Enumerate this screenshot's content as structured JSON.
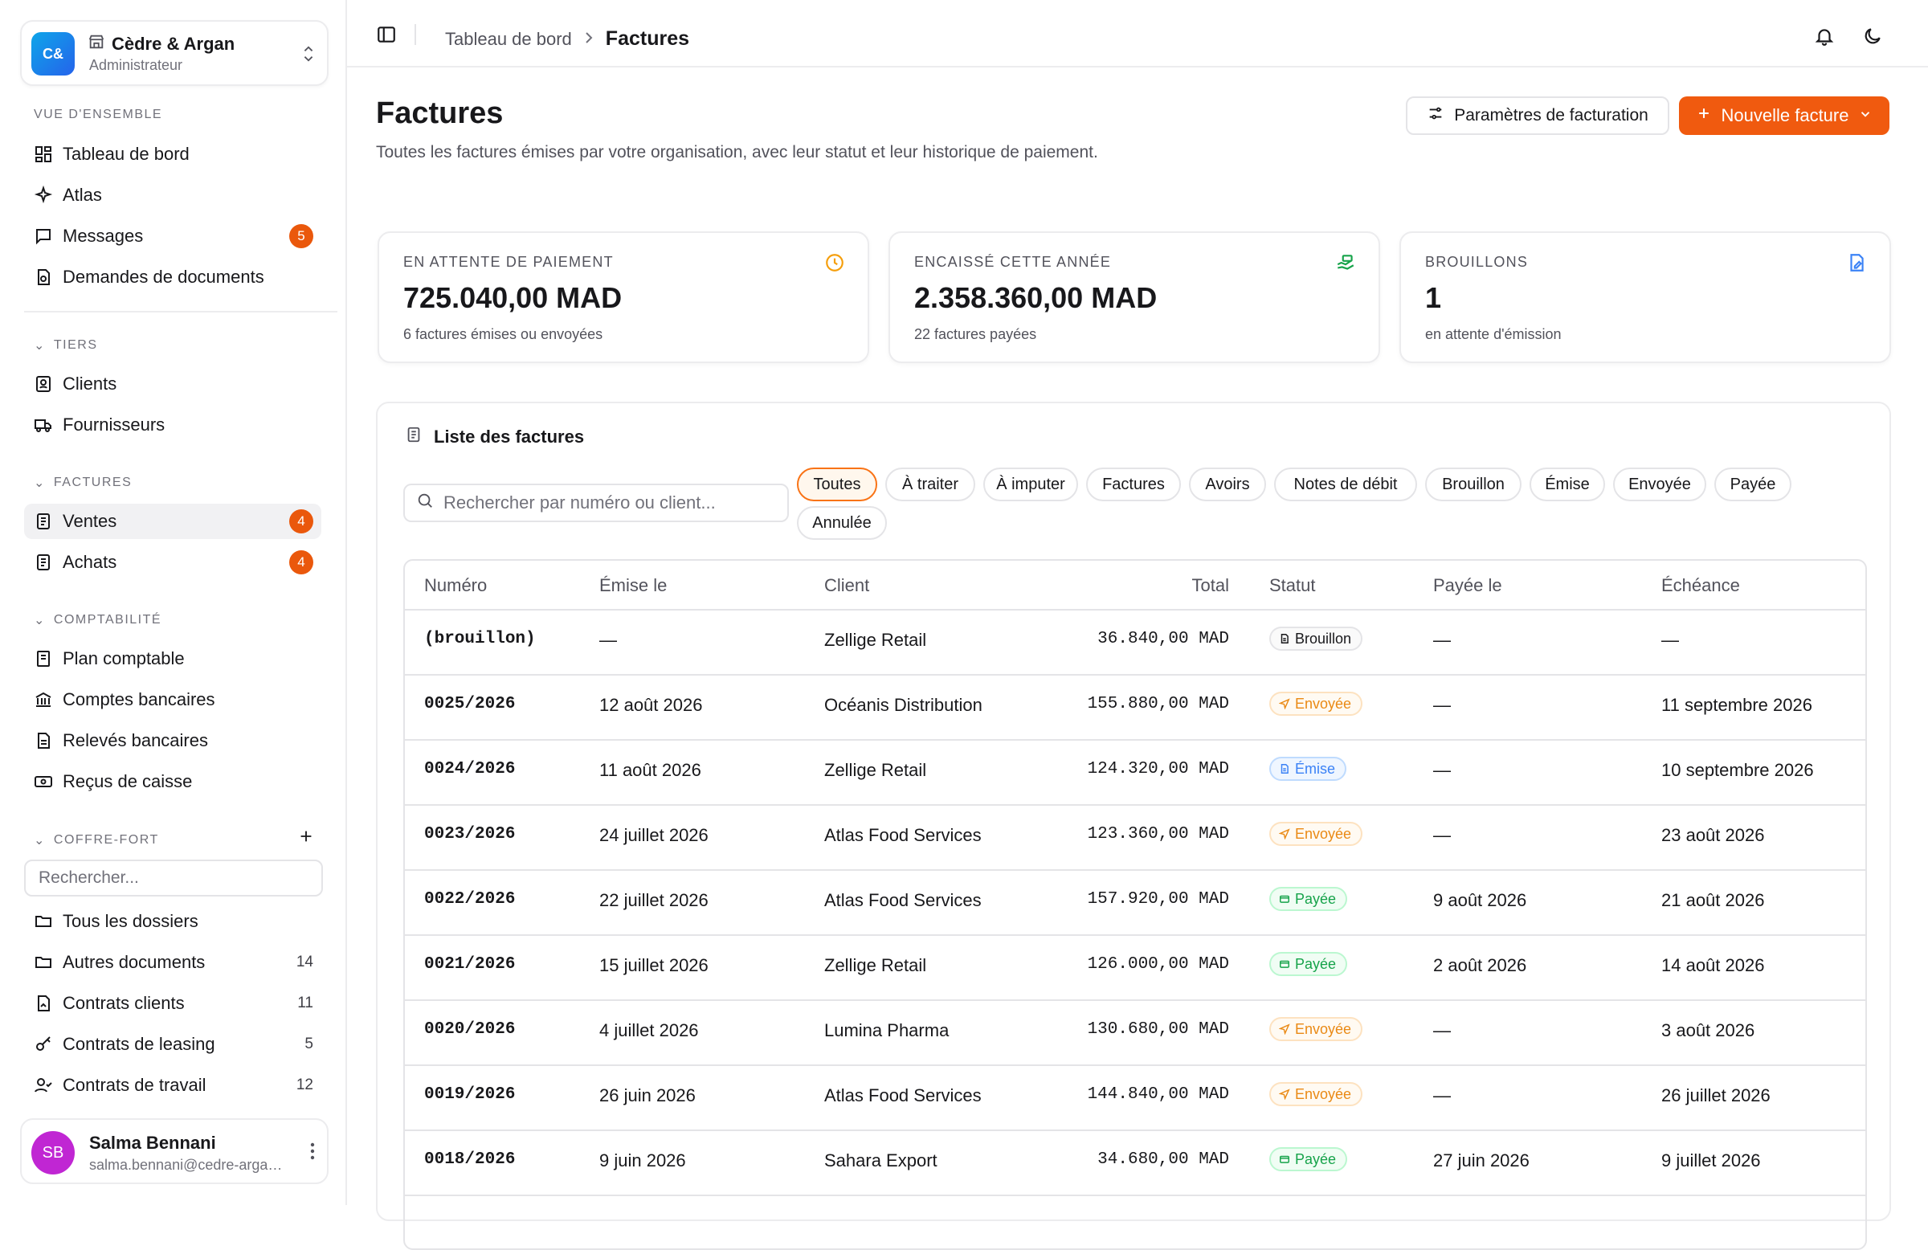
{
  "org": {
    "initials": "C&",
    "name": "Cèdre & Argan",
    "role": "Administrateur"
  },
  "sidebar": {
    "overview": {
      "title": "VUE D'ENSEMBLE",
      "items": [
        {
          "label": "Tableau de bord",
          "icon": "dashboard-icon"
        },
        {
          "label": "Atlas",
          "icon": "sparkle-icon"
        },
        {
          "label": "Messages",
          "icon": "message-icon",
          "badge": "5"
        },
        {
          "label": "Demandes de documents",
          "icon": "document-request-icon"
        }
      ]
    },
    "tiers": {
      "title": "TIERS",
      "items": [
        {
          "label": "Clients"
        },
        {
          "label": "Fournisseurs"
        }
      ]
    },
    "factures": {
      "title": "FACTURES",
      "items": [
        {
          "label": "Ventes",
          "badge": "4"
        },
        {
          "label": "Achats",
          "badge": "4"
        }
      ]
    },
    "compta": {
      "title": "COMPTABILITÉ",
      "items": [
        {
          "label": "Plan comptable"
        },
        {
          "label": "Comptes bancaires"
        },
        {
          "label": "Relevés bancaires"
        },
        {
          "label": "Reçus de caisse"
        }
      ]
    },
    "vault": {
      "title": "COFFRE-FORT",
      "search_placeholder": "Rechercher...",
      "items": [
        {
          "label": "Tous les dossiers",
          "count": ""
        },
        {
          "label": "Autres documents",
          "count": "14"
        },
        {
          "label": "Contrats clients",
          "count": "11"
        },
        {
          "label": "Contrats de leasing",
          "count": "5"
        },
        {
          "label": "Contrats de travail",
          "count": "12"
        }
      ]
    }
  },
  "user": {
    "initials": "SB",
    "name": "Salma Bennani",
    "email": "salma.bennani@cedre-argan.ma"
  },
  "breadcrumb": {
    "parent": "Tableau de bord",
    "current": "Factures"
  },
  "page": {
    "title": "Factures",
    "subtitle": "Toutes les factures émises par votre organisation, avec leur statut et leur historique de paiement.",
    "settings_button": "Paramètres de facturation",
    "new_button": "Nouvelle facture"
  },
  "stats": [
    {
      "label": "EN ATTENTE DE PAIEMENT",
      "value": "725.040,00 MAD",
      "sub": "6 factures émises ou envoyées",
      "color": "#f59e0b"
    },
    {
      "label": "ENCAISSÉ CETTE ANNÉE",
      "value": "2.358.360,00 MAD",
      "sub": "22 factures payées",
      "color": "#16a34a"
    },
    {
      "label": "BROUILLONS",
      "value": "1",
      "sub": "en attente d'émission",
      "color": "#3b82f6"
    }
  ],
  "list": {
    "title": "Liste des factures",
    "search_placeholder": "Rechercher par numéro ou client...",
    "filters": [
      "Toutes",
      "À traiter",
      "À imputer",
      "Factures",
      "Avoirs",
      "Notes de débit",
      "Brouillon",
      "Émise",
      "Envoyée",
      "Payée",
      "Annulée"
    ],
    "active_filter": "Toutes",
    "columns": [
      "Numéro",
      "Émise le",
      "Client",
      "Total",
      "Statut",
      "Payée le",
      "Échéance"
    ],
    "rows": [
      {
        "num": "(brouillon)",
        "issued": "—",
        "client": "Zellige Retail",
        "total": "36.840,00 MAD",
        "status": "Brouillon",
        "paid": "—",
        "due": "—"
      },
      {
        "num": "0025/2026",
        "issued": "12 août 2026",
        "client": "Océanis Distribution",
        "total": "155.880,00 MAD",
        "status": "Envoyée",
        "paid": "—",
        "due": "11 septembre 2026"
      },
      {
        "num": "0024/2026",
        "issued": "11 août 2026",
        "client": "Zellige Retail",
        "total": "124.320,00 MAD",
        "status": "Émise",
        "paid": "—",
        "due": "10 septembre 2026"
      },
      {
        "num": "0023/2026",
        "issued": "24 juillet 2026",
        "client": "Atlas Food Services",
        "total": "123.360,00 MAD",
        "status": "Envoyée",
        "paid": "—",
        "due": "23 août 2026"
      },
      {
        "num": "0022/2026",
        "issued": "22 juillet 2026",
        "client": "Atlas Food Services",
        "total": "157.920,00 MAD",
        "status": "Payée",
        "paid": "9 août 2026",
        "due": "21 août 2026"
      },
      {
        "num": "0021/2026",
        "issued": "15 juillet 2026",
        "client": "Zellige Retail",
        "total": "126.000,00 MAD",
        "status": "Payée",
        "paid": "2 août 2026",
        "due": "14 août 2026"
      },
      {
        "num": "0020/2026",
        "issued": "4 juillet 2026",
        "client": "Lumina Pharma",
        "total": "130.680,00 MAD",
        "status": "Envoyée",
        "paid": "—",
        "due": "3 août 2026"
      },
      {
        "num": "0019/2026",
        "issued": "26 juin 2026",
        "client": "Atlas Food Services",
        "total": "144.840,00 MAD",
        "status": "Envoyée",
        "paid": "—",
        "due": "26 juillet 2026"
      },
      {
        "num": "0018/2026",
        "issued": "9 juin 2026",
        "client": "Sahara Export",
        "total": "34.680,00 MAD",
        "status": "Payée",
        "paid": "27 juin 2026",
        "due": "9 juillet 2026"
      }
    ]
  }
}
